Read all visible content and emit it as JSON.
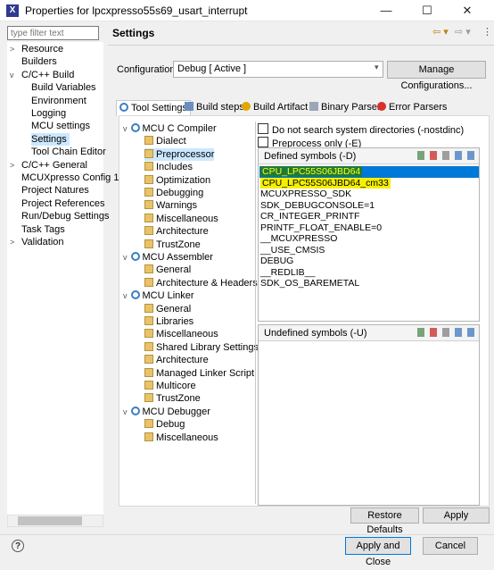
{
  "window": {
    "title": "Properties for lpcxpresso55s69_usart_interrupt",
    "minimize": "—",
    "maximize": "☐",
    "close": "✕"
  },
  "left": {
    "filter_placeholder": "type filter text",
    "tree": [
      {
        "label": "Resource",
        "twisty": ">"
      },
      {
        "label": "Builders",
        "twisty": ""
      },
      {
        "label": "C/C++ Build",
        "twisty": "v"
      },
      {
        "label": "Build Variables",
        "twisty": ""
      },
      {
        "label": "Environment",
        "twisty": ""
      },
      {
        "label": "Logging",
        "twisty": ""
      },
      {
        "label": "MCU settings",
        "twisty": ""
      },
      {
        "label": "Settings",
        "twisty": ""
      },
      {
        "label": "Tool Chain Editor",
        "twisty": ""
      },
      {
        "label": "C/C++ General",
        "twisty": ">"
      },
      {
        "label": "MCUXpresso Config 1",
        "twisty": ""
      },
      {
        "label": "Project Natures",
        "twisty": ""
      },
      {
        "label": "Project References",
        "twisty": ""
      },
      {
        "label": "Run/Debug Settings",
        "twisty": ""
      },
      {
        "label": "Task Tags",
        "twisty": ""
      },
      {
        "label": "Validation",
        "twisty": ">"
      }
    ]
  },
  "header": {
    "title": "Settings",
    "back": "⇦ ▾",
    "forward": "⇨ ▾",
    "menu": "⋮"
  },
  "config": {
    "label": "Configuration:",
    "value": "Debug  [ Active ]",
    "arrow": "▾",
    "manage_button": "Manage Configurations..."
  },
  "tabs": [
    {
      "label": "Tool Settings"
    },
    {
      "label": "Build steps"
    },
    {
      "label": "Build Artifact"
    },
    {
      "label": "Binary Parsers"
    },
    {
      "label": "Error Parsers"
    }
  ],
  "tool_tree": [
    {
      "label": "MCU C Compiler",
      "kind": "gear",
      "twisty": "v"
    },
    {
      "label": "Dialect",
      "kind": "folder"
    },
    {
      "label": "Preprocessor",
      "kind": "folder"
    },
    {
      "label": "Includes",
      "kind": "folder"
    },
    {
      "label": "Optimization",
      "kind": "folder"
    },
    {
      "label": "Debugging",
      "kind": "folder"
    },
    {
      "label": "Warnings",
      "kind": "folder"
    },
    {
      "label": "Miscellaneous",
      "kind": "folder"
    },
    {
      "label": "Architecture",
      "kind": "folder"
    },
    {
      "label": "TrustZone",
      "kind": "folder"
    },
    {
      "label": "MCU Assembler",
      "kind": "gear",
      "twisty": "v"
    },
    {
      "label": "General",
      "kind": "folder"
    },
    {
      "label": "Architecture & Headers",
      "kind": "folder"
    },
    {
      "label": "MCU Linker",
      "kind": "gear",
      "twisty": "v"
    },
    {
      "label": "General",
      "kind": "folder"
    },
    {
      "label": "Libraries",
      "kind": "folder"
    },
    {
      "label": "Miscellaneous",
      "kind": "folder"
    },
    {
      "label": "Shared Library Settings",
      "kind": "folder"
    },
    {
      "label": "Architecture",
      "kind": "folder"
    },
    {
      "label": "Managed Linker Script",
      "kind": "folder"
    },
    {
      "label": "Multicore",
      "kind": "folder"
    },
    {
      "label": "TrustZone",
      "kind": "folder"
    },
    {
      "label": "MCU Debugger",
      "kind": "gear",
      "twisty": "v"
    },
    {
      "label": "Debug",
      "kind": "folder"
    },
    {
      "label": "Miscellaneous",
      "kind": "folder"
    }
  ],
  "options": {
    "nostdinc": "Do not search system directories (-nostdinc)",
    "preprocess_only": "Preprocess only (-E)"
  },
  "defined": {
    "header": "Defined symbols (-D)",
    "symbols": [
      "CPU_LPC55S06JBD64",
      "CPU_LPC55S06JBD64_cm33",
      "MCUXPRESSO_SDK",
      "SDK_DEBUGCONSOLE=1",
      "CR_INTEGER_PRINTF",
      "PRINTF_FLOAT_ENABLE=0",
      "__MCUXPRESSO",
      "__USE_CMSIS",
      "DEBUG",
      "__REDLIB__",
      "SDK_OS_BAREMETAL"
    ]
  },
  "undefined": {
    "header": "Undefined symbols (-U)"
  },
  "buttons": {
    "restore": "Restore Defaults",
    "apply": "Apply",
    "apply_close": "Apply and Close",
    "cancel": "Cancel",
    "help": "?"
  },
  "colors": {
    "selection_blue": "#0078d7",
    "highlight_green": "#1e7a3c",
    "highlight_yellow": "#f5f000",
    "tree_selection": "#cce8ff"
  }
}
